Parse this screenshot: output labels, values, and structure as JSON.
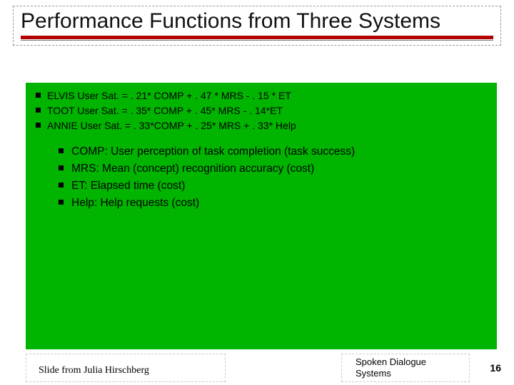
{
  "title": "Performance Functions from Three Systems",
  "equations": [
    "ELVIS User Sat. = . 21* COMP + . 47 * MRS - . 15 * ET",
    "TOOT User Sat. = . 35* COMP + . 45* MRS - . 14*ET",
    "ANNIE User Sat. = . 33*COMP + . 25* MRS + . 33* Help"
  ],
  "definitions": [
    "COMP: User perception of task completion (task success)",
    "MRS: Mean (concept) recognition accuracy  (cost)",
    "ET:  Elapsed time (cost)",
    "Help: Help requests (cost)"
  ],
  "footer": {
    "attribution": "Slide from Julia Hirschberg",
    "course": "Spoken Dialogue Systems",
    "page": "16"
  }
}
